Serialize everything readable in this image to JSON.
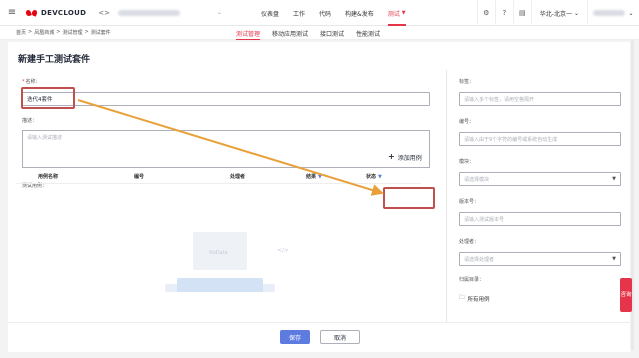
{
  "header": {
    "menu_icon": "hamburger-icon",
    "brand_name": "DEVCLOUD",
    "project_icon_text": "<>",
    "nav": [
      "仪表盘",
      "工作",
      "代码",
      "构建&发布",
      "测试"
    ],
    "active_nav": "测试",
    "region": "华北-北京一",
    "icons": [
      "settings-icon",
      "help-icon",
      "document-icon"
    ]
  },
  "breadcrumb": [
    "首页",
    ">",
    "凤凰商城",
    ">",
    "测试管理",
    ">",
    "测试套件"
  ],
  "tabs": [
    "测试管理",
    "移动应用测试",
    "接口测试",
    "性能测试"
  ],
  "active_tab": "测试管理",
  "page_title": "新建手工测试套件",
  "form": {
    "name_label": "名称：",
    "name_value": "迭代4套件",
    "desc_label": "描述：",
    "desc_placeholder": "请输入测试描述",
    "cases_label": "测试用例：",
    "add_case_label": "添加用例",
    "columns": [
      "用例名称",
      "编号",
      "处理者",
      "结果",
      "状态"
    ],
    "empty_text": "NoData",
    "empty_code": "</>"
  },
  "side_form": {
    "tags_label": "标签：",
    "tags_placeholder": "请输入多个标签，请用空格隔开",
    "number_label": "编号：",
    "number_placeholder": "请输入由于9个字符的编号或系统自动生成",
    "module_label": "模块：",
    "module_placeholder": "请选择模块",
    "version_label": "版本号：",
    "version_placeholder": "请输入测试版本号",
    "handler_label": "处理者：",
    "handler_placeholder": "请选择处理者",
    "dir_label": "归属目录：",
    "dir_value": "所有用例"
  },
  "footer": {
    "save": "保存",
    "cancel": "取消"
  },
  "side_tab": "咨询",
  "colors": {
    "accent": "#e6354a",
    "primary": "#5e7ce0",
    "annotation": "#c0504d",
    "arrow": "#e8a13a"
  }
}
